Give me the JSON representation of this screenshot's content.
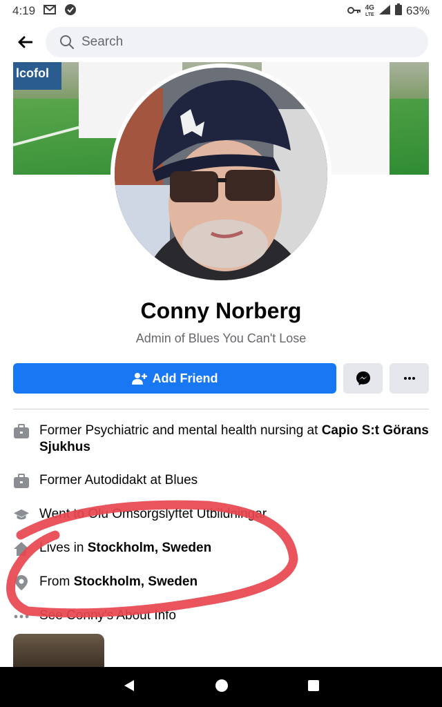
{
  "status": {
    "time": "4:19",
    "network": "4G",
    "network_sub": "LTE",
    "battery": "63%"
  },
  "search": {
    "placeholder": "Search"
  },
  "cover": {
    "board_text": "lcofol"
  },
  "profile": {
    "name": "Conny Norberg",
    "subtitle": "Admin of Blues You Can't Lose"
  },
  "actions": {
    "add_friend_label": "Add Friend",
    "accent": "#1877f2"
  },
  "info": {
    "work1_prefix": "Former Psychiatric and mental health nursing at ",
    "work1_bold": "Capio S:t Görans Sjukhus",
    "work2": "Former Autodidakt at Blues",
    "education": "Went to Olu Omsorgslyftet Utbildningar",
    "lives_prefix": "Lives in ",
    "lives_bold": "Stockholm, Sweden",
    "from_prefix": "From ",
    "from_bold": "Stockholm, Sweden",
    "about": "See Conny's About Info"
  },
  "annotation": {
    "color": "#e8474f"
  },
  "icons": [
    "back-arrow-icon",
    "search-icon",
    "add-friend-icon",
    "messenger-icon",
    "more-icon",
    "briefcase-icon",
    "graduation-cap-icon",
    "home-icon",
    "location-pin-icon",
    "ellipsis-icon",
    "back-triangle-icon",
    "home-circle-icon",
    "recents-square-icon"
  ]
}
